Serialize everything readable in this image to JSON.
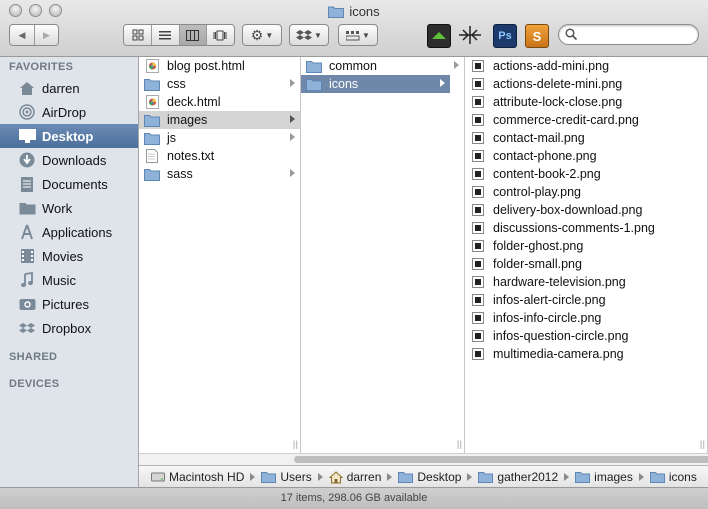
{
  "window": {
    "title": "icons"
  },
  "toolbar": {
    "back_label": "◀",
    "forward_label": "▶",
    "view_modes": [
      "icon-view",
      "list-view",
      "column-view",
      "coverflow-view"
    ],
    "search": {
      "placeholder": "",
      "value": ""
    }
  },
  "sidebar": {
    "favorites_heading": "FAVORITES",
    "shared_heading": "SHARED",
    "devices_heading": "DEVICES",
    "items": [
      {
        "label": "darren",
        "icon": "home-icon"
      },
      {
        "label": "AirDrop",
        "icon": "airdrop-icon"
      },
      {
        "label": "Desktop",
        "icon": "desktop-icon",
        "selected": true
      },
      {
        "label": "Downloads",
        "icon": "downloads-icon"
      },
      {
        "label": "Documents",
        "icon": "documents-icon"
      },
      {
        "label": "Work",
        "icon": "folder-icon"
      },
      {
        "label": "Applications",
        "icon": "applications-icon"
      },
      {
        "label": "Movies",
        "icon": "movies-icon"
      },
      {
        "label": "Music",
        "icon": "music-icon"
      },
      {
        "label": "Pictures",
        "icon": "pictures-icon"
      },
      {
        "label": "Dropbox",
        "icon": "dropbox-icon"
      }
    ]
  },
  "columns": {
    "col1": [
      {
        "name": "blog post.html",
        "type": "html"
      },
      {
        "name": "css",
        "type": "folder"
      },
      {
        "name": "deck.html",
        "type": "html"
      },
      {
        "name": "images",
        "type": "folder",
        "state": "selected-inactive"
      },
      {
        "name": "js",
        "type": "folder"
      },
      {
        "name": "notes.txt",
        "type": "text"
      },
      {
        "name": "sass",
        "type": "folder"
      }
    ],
    "col2": [
      {
        "name": "common",
        "type": "folder"
      },
      {
        "name": "icons",
        "type": "folder",
        "state": "selected-active"
      }
    ],
    "col3": [
      "actions-add-mini.png",
      "actions-delete-mini.png",
      "attribute-lock-close.png",
      "commerce-credit-card.png",
      "contact-mail.png",
      "contact-phone.png",
      "content-book-2.png",
      "control-play.png",
      "delivery-box-download.png",
      "discussions-comments-1.png",
      "folder-ghost.png",
      "folder-small.png",
      "hardware-television.png",
      "infos-alert-circle.png",
      "infos-info-circle.png",
      "infos-question-circle.png",
      "multimedia-camera.png"
    ]
  },
  "pathbar": [
    "Macintosh HD",
    "Users",
    "darren",
    "Desktop",
    "gather2012",
    "images",
    "icons"
  ],
  "status": "17 items, 298.06 GB available",
  "colors": {
    "selection_active": "#6f87a8",
    "sidebar_bg": "#dee4ea",
    "sidebar_selection": "#4b6e9b"
  }
}
